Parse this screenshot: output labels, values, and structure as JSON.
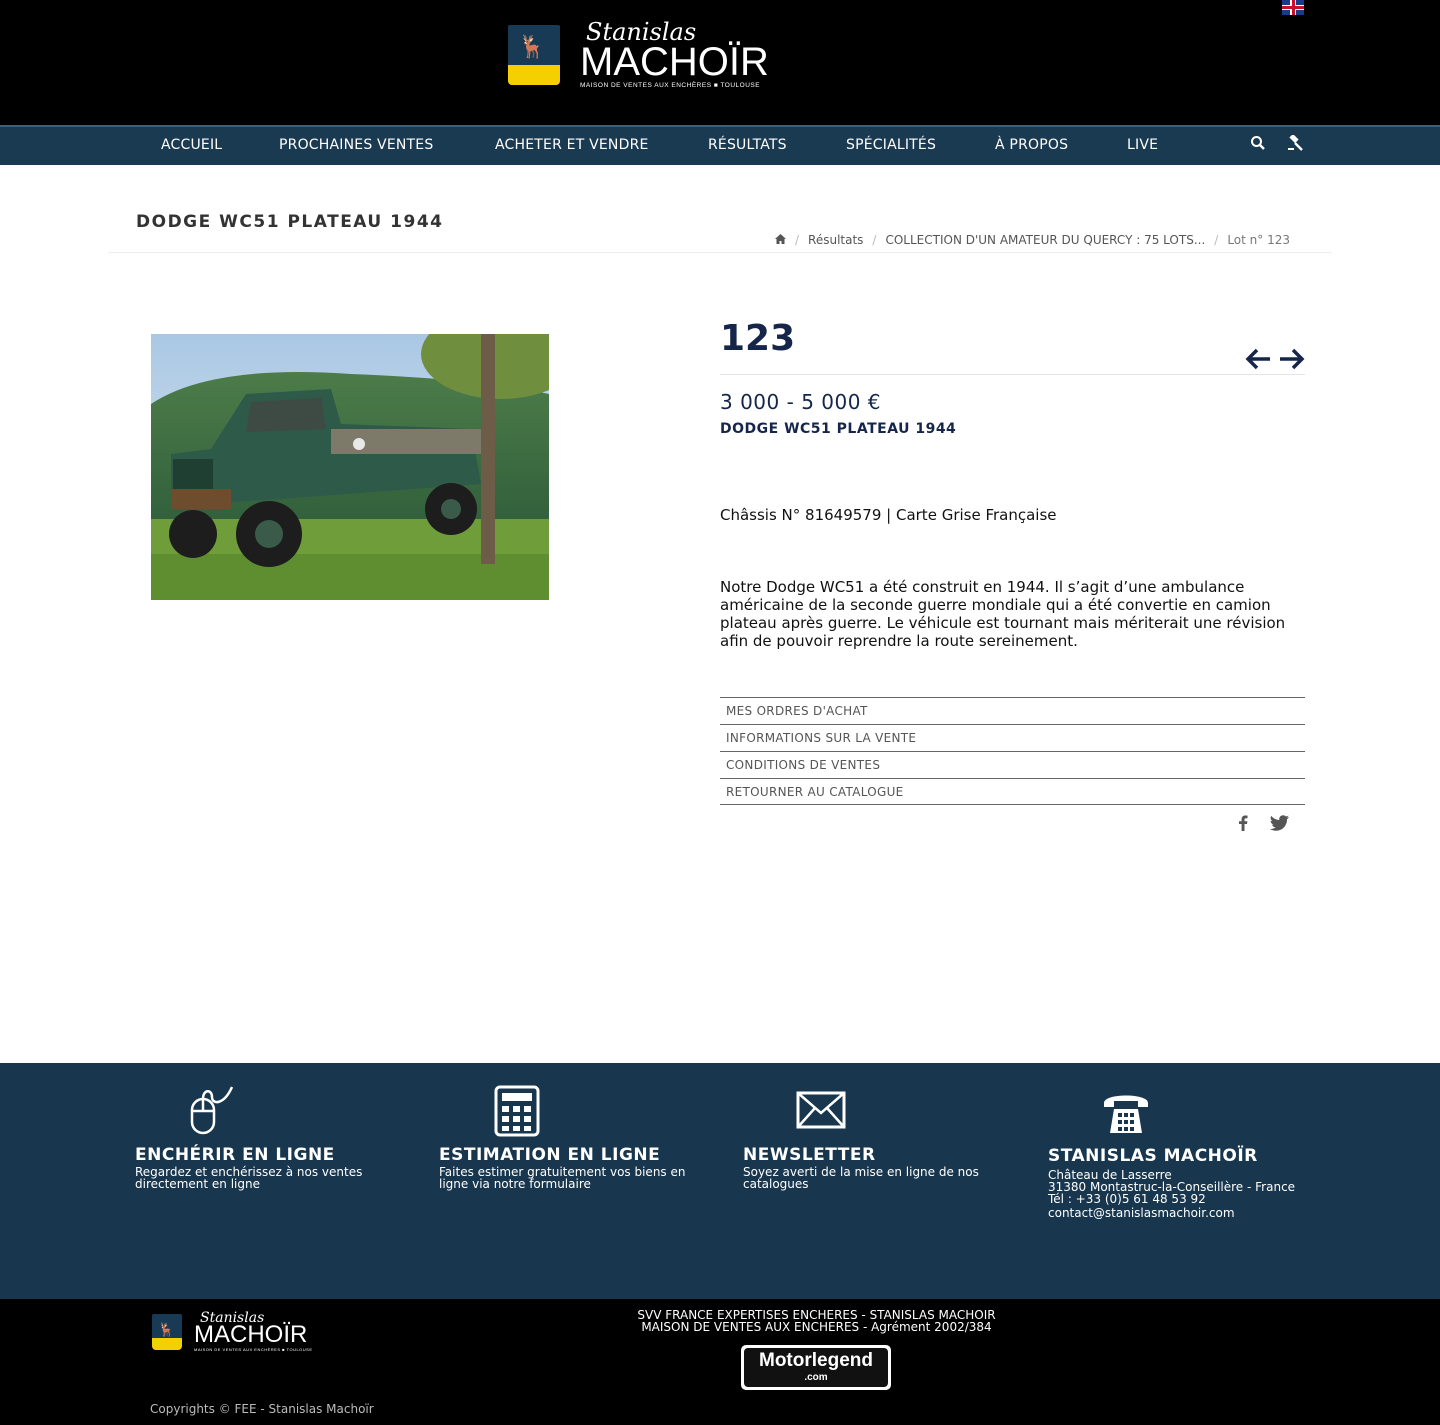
{
  "header": {
    "logo": {
      "script": "Stanislas",
      "main": "MACHOÏR",
      "sub": "MAISON DE VENTES AUX ENCHÈRES ■ TOULOUSE"
    },
    "language_flag": "uk-flag-icon"
  },
  "nav": {
    "items": [
      "ACCUEIL",
      "PROCHAINES VENTES",
      "ACHETER ET VENDRE",
      "RÉSULTATS",
      "SPÉCIALITÉS",
      "À PROPOS",
      "LIVE"
    ],
    "icons": [
      "search-icon",
      "gavel-icon"
    ]
  },
  "page": {
    "title": "DODGE WC51 PLATEAU 1944",
    "breadcrumb": [
      "Résultats",
      "COLLECTION D'UN AMATEUR DU QUERCY : 75 LOTS...",
      "Lot n° 123"
    ]
  },
  "lot": {
    "number": "123",
    "estimate": "3 000 - 5 000 €",
    "name": "DODGE WC51 PLATEAU 1944",
    "chassis": "Châssis N° 81649579 | Carte Grise Française",
    "description": "Notre Dodge WC51 a été construit en 1944. Il s’agit d’une ambulance américaine de la seconde guerre mondiale qui a été convertie en camion plateau après guerre. Le véhicule est tournant mais mériterait une révision afin de pouvoir reprendre la route sereinement.",
    "links": [
      "MES ORDRES D'ACHAT",
      "INFORMATIONS SUR LA VENTE",
      "CONDITIONS DE VENTES",
      "RETOURNER AU CATALOGUE"
    ],
    "arrows": {
      "prev": "←",
      "next": "→"
    }
  },
  "footer": {
    "cols": [
      {
        "icon": "mouse-icon",
        "title": "ENCHÉRIR EN LIGNE",
        "lines": [
          "Regardez et enchérissez à nos ventes",
          "directement en ligne"
        ]
      },
      {
        "icon": "calculator-icon",
        "title": "ESTIMATION EN LIGNE",
        "lines": [
          "Faites estimer gratuitement vos biens en",
          "ligne via notre formulaire"
        ]
      },
      {
        "icon": "envelope-icon",
        "title": "NEWSLETTER",
        "lines": [
          "Soyez averti de la mise en ligne de nos",
          "catalogues"
        ]
      },
      {
        "icon": "phone-icon",
        "title": "STANISLAS MACHOÏR",
        "lines": [
          "Château de Lasserre",
          "31380 Montastruc-la-Conseillère - France",
          "Tél : +33 (0)5 61 48 53 92"
        ],
        "email": "contact@stanislasmachoir.com"
      }
    ],
    "svv_line1": "SVV FRANCE EXPERTISES ENCHERES - STANISLAS MACHOIR",
    "svv_line2": "MAISON DE VENTES AUX ENCHERES - Agrément 2002/384",
    "partner": {
      "main": "Motorlegend",
      "sub": ".com"
    },
    "copyright": "Copyrights © FEE - Stanislas Machoïr"
  }
}
